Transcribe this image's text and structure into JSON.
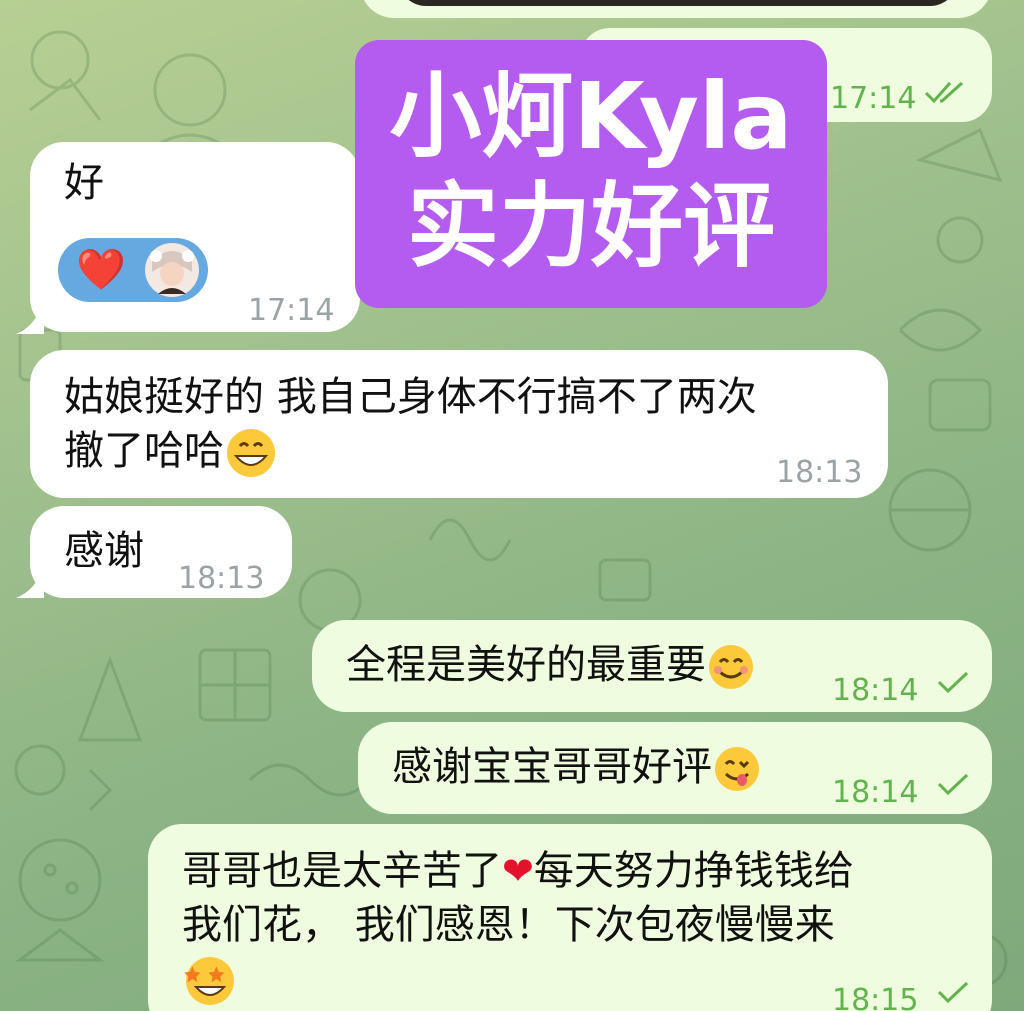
{
  "banner": {
    "line1": "小炣Kyla",
    "line2": "实力好评"
  },
  "messages": [
    {
      "id": "m0",
      "direction": "out",
      "text": "",
      "time": "17:14",
      "status": "read"
    },
    {
      "id": "m1",
      "direction": "in",
      "text": "好",
      "time": "17:14",
      "reaction": "❤️"
    },
    {
      "id": "m2",
      "direction": "in",
      "line1": "姑娘挺好的 我自己身体不行搞不了两次",
      "line2": "撤了哈哈",
      "time": "18:13",
      "emoji": "grinning-face"
    },
    {
      "id": "m3",
      "direction": "in",
      "text": "感谢",
      "time": "18:13"
    },
    {
      "id": "m4",
      "direction": "out",
      "text": "全程是美好的最重要",
      "time": "18:14",
      "status": "sent",
      "emoji": "smiling-face"
    },
    {
      "id": "m5",
      "direction": "out",
      "text": "感谢宝宝哥哥好评",
      "time": "18:14",
      "status": "sent",
      "emoji": "yum-face"
    },
    {
      "id": "m6",
      "direction": "out",
      "line1a": "哥哥也是太辛苦了",
      "line1b": "每天努力挣钱钱给",
      "line2": "我们花， 我们感恩！下次包夜慢慢来",
      "time": "18:15",
      "status": "sent",
      "emoji": "star-struck-face"
    }
  ],
  "colors": {
    "incoming_bubble": "#ffffff",
    "outgoing_bubble": "#effcdf",
    "outgoing_time": "#62b34e",
    "incoming_time": "#9aa3a6",
    "banner": "#b45cf0",
    "reaction": "#65a9e0"
  }
}
